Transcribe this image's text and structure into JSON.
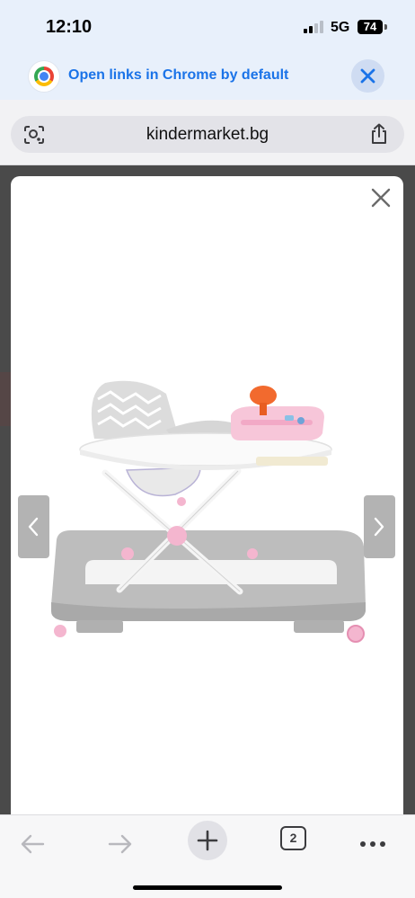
{
  "status_bar": {
    "time": "12:10",
    "network": "5G",
    "battery": "74"
  },
  "banner": {
    "text": "Open links in Chrome by default",
    "icon": "chrome-icon",
    "close_icon": "close-icon"
  },
  "address_bar": {
    "url": "kindermarket.bg",
    "left_icon": "lens-icon",
    "right_icon": "share-icon"
  },
  "lightbox": {
    "close_icon": "close-icon",
    "prev_icon": "chevron-left-icon",
    "next_icon": "chevron-right-icon",
    "image": "baby-walker-product-image"
  },
  "toolbar": {
    "tab_count": "2",
    "icons": [
      "back-arrow-icon",
      "forward-arrow-icon",
      "plus-icon",
      "tabs-icon",
      "more-icon"
    ]
  },
  "colors": {
    "banner_bg": "#e8f0fb",
    "banner_text": "#1a73e8",
    "backdrop": "#4a4a4a",
    "walker_gray": "#bdbdbd",
    "walker_pink": "#f4b6cf",
    "walker_orange": "#f26a2e"
  }
}
